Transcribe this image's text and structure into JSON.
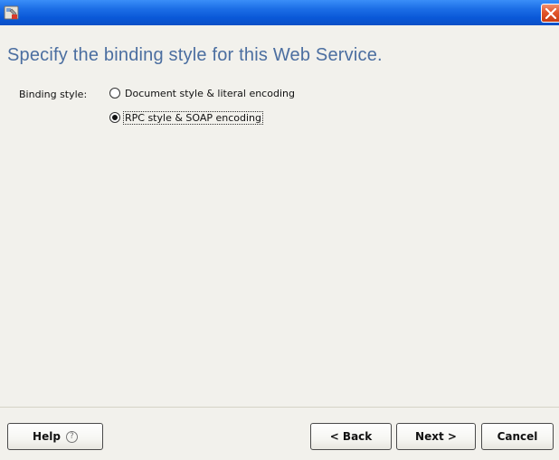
{
  "window": {
    "icon": "wizard-tool-icon",
    "close_icon": "close-icon"
  },
  "header": {
    "title": "Specify the binding style for this Web Service."
  },
  "binding": {
    "label": "Binding style:",
    "options": [
      {
        "label": "Document style & literal encoding",
        "selected": false
      },
      {
        "label": "RPC style & SOAP encoding",
        "selected": true
      }
    ]
  },
  "footer": {
    "help_label": "Help",
    "help_icon": "?",
    "back_label": "< Back",
    "next_label": "Next >",
    "cancel_label": "Cancel"
  },
  "colors": {
    "titlebar": "#0a58d8",
    "title_text": "#4b6ea0",
    "close_button": "#e2552b",
    "background": "#f2f1ec"
  }
}
